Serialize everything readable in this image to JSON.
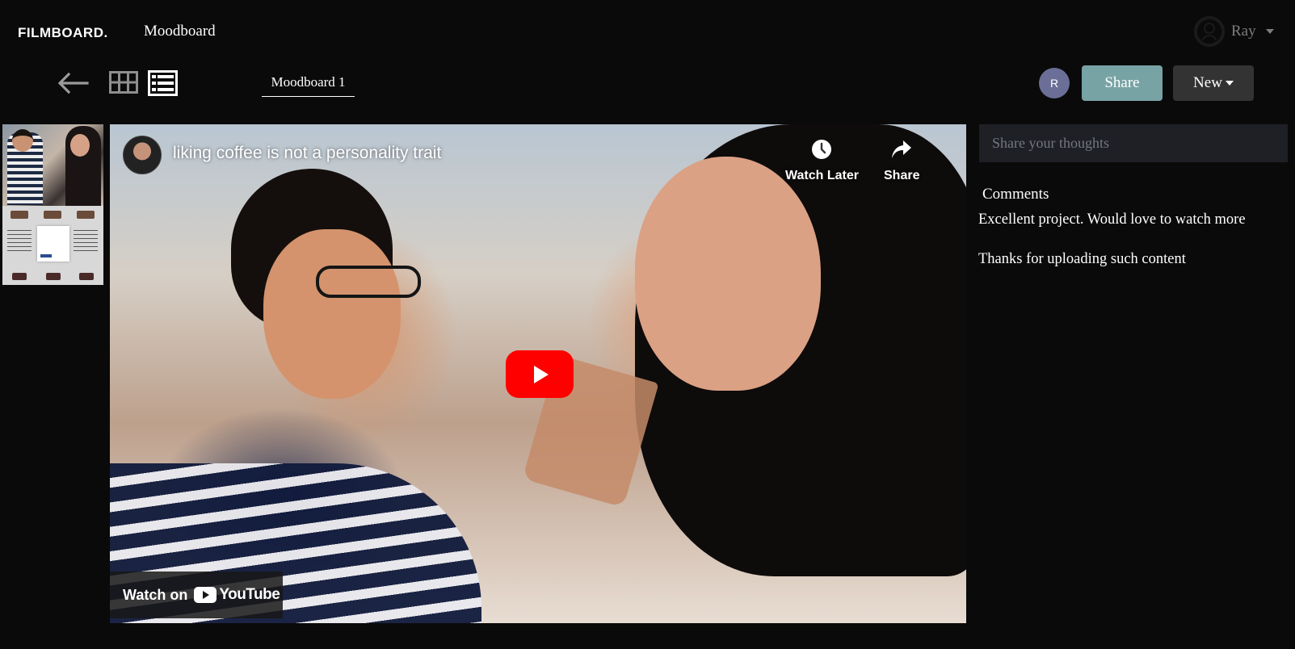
{
  "header": {
    "brand": "FILMBOARD.",
    "nav_title": "Moodboard",
    "user": {
      "name": "Ray",
      "icon": "user-outline-icon"
    }
  },
  "toolbar": {
    "back_icon": "arrow-left-icon",
    "grid_icon": "grid-view-icon",
    "list_icon": "list-view-icon",
    "active_tab": "Moodboard 1",
    "collaborator_initial": "R",
    "share_label": "Share",
    "new_label": "New",
    "colors": {
      "share": "#78a3a5",
      "new": "#333333",
      "avatar": "#6b6f97"
    }
  },
  "video": {
    "title": "liking coffee is not a personality trait",
    "watch_later_label": "Watch Later",
    "share_label": "Share",
    "watch_on_label": "Watch on",
    "youtube_label": "YouTube",
    "play_color": "#ff0000"
  },
  "sidebar": {
    "input_placeholder": "Share your thoughts",
    "comments_label": "Comments",
    "comments": [
      "Excellent project. Would love to watch more",
      "Thanks for uploading such content"
    ]
  }
}
